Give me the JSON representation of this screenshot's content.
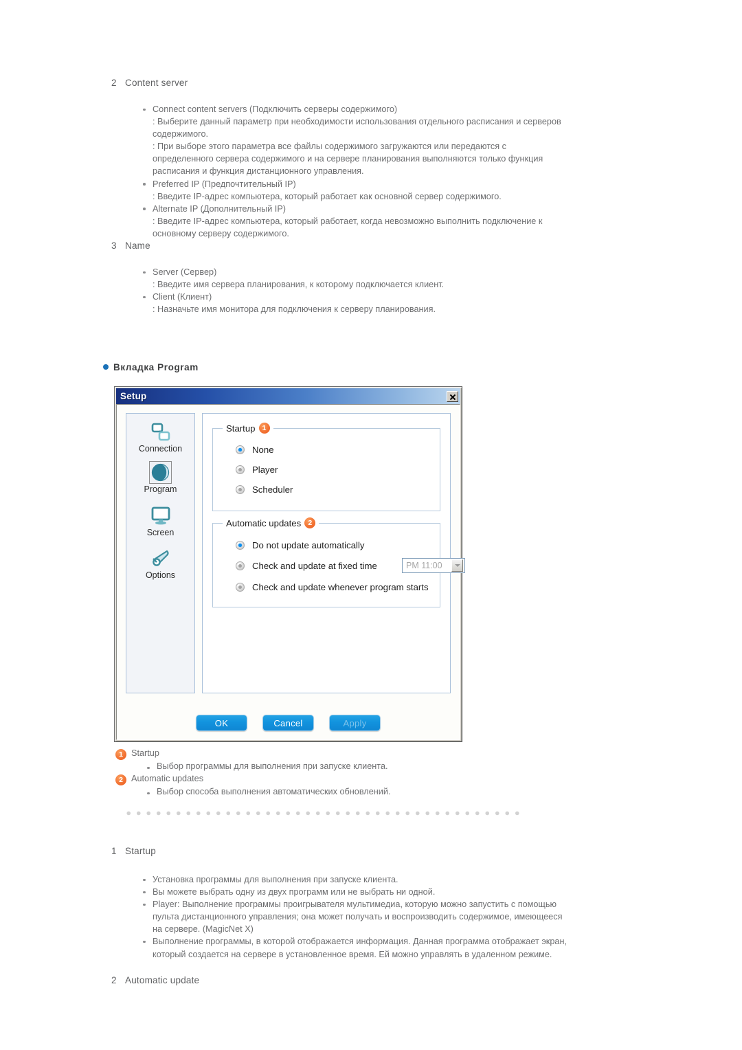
{
  "section_content_server": {
    "number": "2",
    "title": "Content server",
    "items": [
      {
        "label": "Connect content servers (Подключить серверы содержимого)",
        "lines": [
          ": Выберите данный параметр при необходимости использования отдельного расписания и серверов содержимого.",
          ": При выборе этого параметра все файлы содержимого загружаются или передаются с определенного сервера содержимого и на сервере планирования выполняются только функция расписания и функция дистанционного управления."
        ]
      },
      {
        "label": "Preferred IP (Предпочтительный IP)",
        "lines": [
          ": Введите IP-адрес компьютера, который работает как основной сервер содержимого."
        ]
      },
      {
        "label": "Alternate IP (Дополнительный IP)",
        "lines": [
          ": Введите IP-адрес компьютера, который работает, когда невозможно выполнить подключение к основному серверу содержимого."
        ]
      }
    ]
  },
  "section_name": {
    "number": "3",
    "title": "Name",
    "items": [
      {
        "label": "Server (Сервер)",
        "lines": [
          ": Введите имя сервера планирования, к которому подключается клиент."
        ]
      },
      {
        "label": "Client (Клиент)",
        "lines": [
          ": Назначьте имя монитора для подключения к серверу планирования."
        ]
      }
    ]
  },
  "tab_heading": "Вкладка Program",
  "dialog": {
    "title": "Setup",
    "close_label": "×",
    "nav": [
      {
        "label": "Connection",
        "icon": "connection-icon",
        "selected": false
      },
      {
        "label": "Program",
        "icon": "globe-icon",
        "selected": true
      },
      {
        "label": "Screen",
        "icon": "monitor-icon",
        "selected": false
      },
      {
        "label": "Options",
        "icon": "wrench-icon",
        "selected": false
      }
    ],
    "startup_group": {
      "title": "Startup",
      "badge": "1",
      "options": [
        {
          "label": "None",
          "selected": true
        },
        {
          "label": "Player",
          "selected": false
        },
        {
          "label": "Scheduler",
          "selected": false
        }
      ]
    },
    "updates_group": {
      "title": "Automatic updates",
      "badge": "2",
      "options": [
        {
          "label": "Do not update automatically",
          "selected": true
        },
        {
          "label": "Check and update at fixed time",
          "selected": false
        },
        {
          "label": "Check and update whenever program starts",
          "selected": false
        }
      ],
      "time_value": "PM 11:00"
    },
    "buttons": [
      {
        "label": "OK",
        "disabled": false
      },
      {
        "label": "Cancel",
        "disabled": false
      },
      {
        "label": "Apply",
        "disabled": true
      }
    ]
  },
  "legend": [
    {
      "badge": "1",
      "title": "Startup",
      "bullets": [
        "Выбор программы для выполнения при запуске клиента."
      ]
    },
    {
      "badge": "2",
      "title": "Automatic updates",
      "bullets": [
        "Выбор способа выполнения автоматических обновлений."
      ]
    }
  ],
  "section_startup": {
    "number": "1",
    "title": "Startup",
    "bullets": [
      "Установка программы для выполнения при запуске клиента.",
      "Вы можете выбрать одну из двух программ или не выбрать ни одной.",
      "Player: Выполнение программы проигрывателя мультимедиа, которую можно запустить с помощью пульта дистанционного управления; она может получать и воспроизводить содержимое, имеющееся на сервере. (MagicNet X)",
      "Выполнение программы, в которой отображается информация. Данная программа отображает экран, который создается на сервере в установленное время. Ей можно управлять в удаленном режиме."
    ]
  },
  "section_automatic_update": {
    "number": "2",
    "title": "Automatic update"
  },
  "colors": {
    "accent_orange": "#f0692a",
    "accent_blue": "#1b72b8",
    "button_blue": "#1293de",
    "icon_teal": "#3d8e9e",
    "radio_selected": "#0b8ff0"
  }
}
